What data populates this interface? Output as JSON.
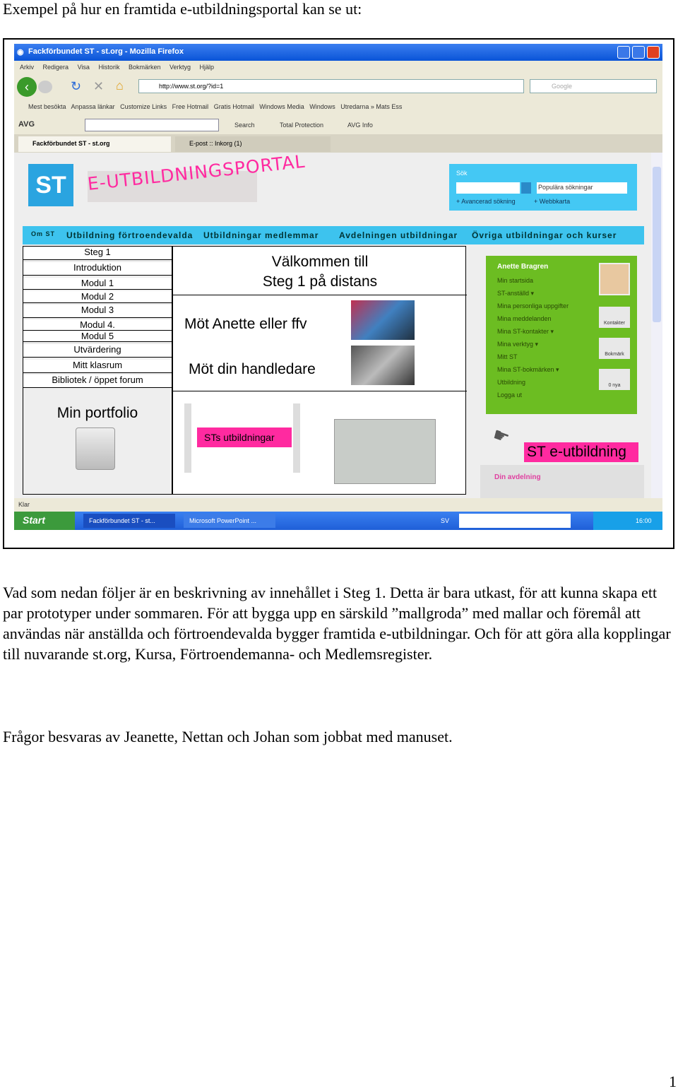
{
  "intro": "Exempel på hur en framtida e-utbildningsportal kan se ut:",
  "browser": {
    "title": "Fackförbundet ST - st.org - Mozilla Firefox",
    "menu": [
      "Arkiv",
      "Redigera",
      "Visa",
      "Historik",
      "Bokmärken",
      "Verktyg",
      "Hjälp"
    ],
    "url": "http://www.st.org/?id=1",
    "search_placeholder": "Google",
    "bookmarks": [
      "Mest besökta",
      "Anpassa länkar",
      "Customize Links",
      "Free Hotmail",
      "Gratis Hotmail",
      "Windows Media",
      "Windows",
      "Utredarna » Mats Ess"
    ],
    "avg": {
      "logo": "AVG",
      "search": "Search",
      "protection": "Total Protection",
      "info": "AVG Info"
    },
    "tabs": [
      "Fackförbundet ST - st.org",
      "E-post :: Inkorg (1)"
    ],
    "status": "Klar"
  },
  "portal": {
    "logo": "ST",
    "title": "E-UTBILDNINGSPORTAL",
    "search": {
      "label": "Sök",
      "dropdown": "Populära sökningar",
      "adv": "+ Avancerad sökning",
      "sitemap": "+ Webbkarta"
    },
    "nav": [
      "Om ST",
      "Utbildning förtroendevalda",
      "Utbildningar medlemmar",
      "Avdelningen utbildningar",
      "Övriga utbildningar och kurser"
    ],
    "left_menu": [
      "Steg 1",
      "Introduktion",
      "Modul 1",
      "Modul 2",
      "Modul 3",
      "Modul 4.",
      "Modul 5",
      "Utvärdering",
      "Mitt klasrum",
      "Bibliotek / öppet forum"
    ],
    "portfolio": "Min portfolio",
    "welcome": [
      "Välkommen till",
      "Steg 1 på distans"
    ],
    "meet_anette": "Möt Anette eller ffv",
    "meet_supervisor": "Möt din handledare",
    "st_courses": "STs utbildningar",
    "user": {
      "name": "Anette Bragren",
      "links": [
        "Min startsida",
        "ST-anställd ▾",
        "Mina personliga uppgifter",
        "Mina meddelanden",
        "Mina ST-kontakter ▾",
        "Mina verktyg ▾",
        "Mitt ST",
        "Mina ST-bokmärken ▾",
        "Utbildning",
        "Logga ut"
      ],
      "buttons": [
        "Kontakter",
        "Bokmärk",
        "0 nya"
      ]
    },
    "st_eutb": "ST e-utbildning",
    "din_avd": "Din avdelning"
  },
  "taskbar": {
    "start": "Start",
    "items": [
      "Fackförbundet ST - st...",
      "Microsoft PowerPoint ..."
    ],
    "lang": "SV",
    "clock": "16:00"
  },
  "paragraph1": "Vad som nedan följer är en beskrivning av innehållet i Steg 1. Detta är bara utkast, för att kunna skapa ett par prototyper under sommaren. För att bygga upp en särskild ”mallgroda” med mallar och föremål att användas när anställda och förtroendevalda bygger framtida e-utbildningar. Och för att göra alla kopplingar till nuvarande st.org, Kursa, Förtroendemanna- och Medlemsregister.",
  "paragraph2": "Frågor besvaras av Jeanette, Nettan och Johan som jobbat med manuset.",
  "page_number": "1",
  "colors": {
    "nav": "#3dc3ee",
    "green": "#6cbd22",
    "pink": "#ff2aa0",
    "xp_blue": "#1f5fd8"
  }
}
